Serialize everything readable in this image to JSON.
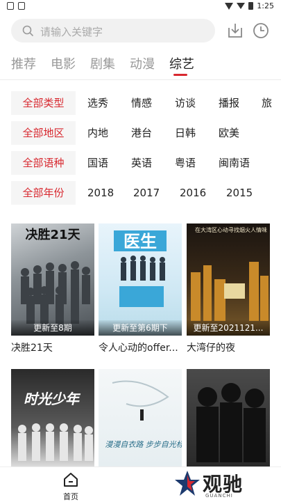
{
  "status_bar": {
    "time": "1:25"
  },
  "search": {
    "placeholder": "请输入关键字"
  },
  "tabs": [
    {
      "label": "推荐",
      "active": false
    },
    {
      "label": "电影",
      "active": false
    },
    {
      "label": "剧集",
      "active": false
    },
    {
      "label": "动漫",
      "active": false
    },
    {
      "label": "综艺",
      "active": true
    }
  ],
  "filters": [
    {
      "all": "全部类型",
      "options": [
        "选秀",
        "情感",
        "访谈",
        "播报",
        "旅"
      ]
    },
    {
      "all": "全部地区",
      "options": [
        "内地",
        "港台",
        "日韩",
        "欧美"
      ]
    },
    {
      "all": "全部语种",
      "options": [
        "国语",
        "英语",
        "粤语",
        "闽南语"
      ]
    },
    {
      "all": "全部年份",
      "options": [
        "2018",
        "2017",
        "2016",
        "2015"
      ]
    }
  ],
  "cards": [
    {
      "title": "决胜21天",
      "badge": "更新至8期",
      "poster_text": "决胜21天"
    },
    {
      "title": "令人心动的offer...",
      "badge": "更新至第6期下",
      "poster_text": "医生"
    },
    {
      "title": "大湾仔的夜",
      "badge": "更新至2021121...",
      "poster_text": "在大湾区心动寻找烟火人情味"
    },
    {
      "title": "",
      "badge": "",
      "poster_text": "时光少年"
    },
    {
      "title": "",
      "badge": "",
      "poster_text": "漫漫自衣路 步步自光标"
    },
    {
      "title": "",
      "badge": "",
      "poster_text": ""
    }
  ],
  "bottom_nav": {
    "home_label": "首页"
  },
  "logo": {
    "name": "观驰",
    "sub": "GUANCHI"
  },
  "colors": {
    "accent": "#d8282f",
    "search_bg": "#f1f1f1",
    "chip_bg": "#f5f5f5"
  }
}
